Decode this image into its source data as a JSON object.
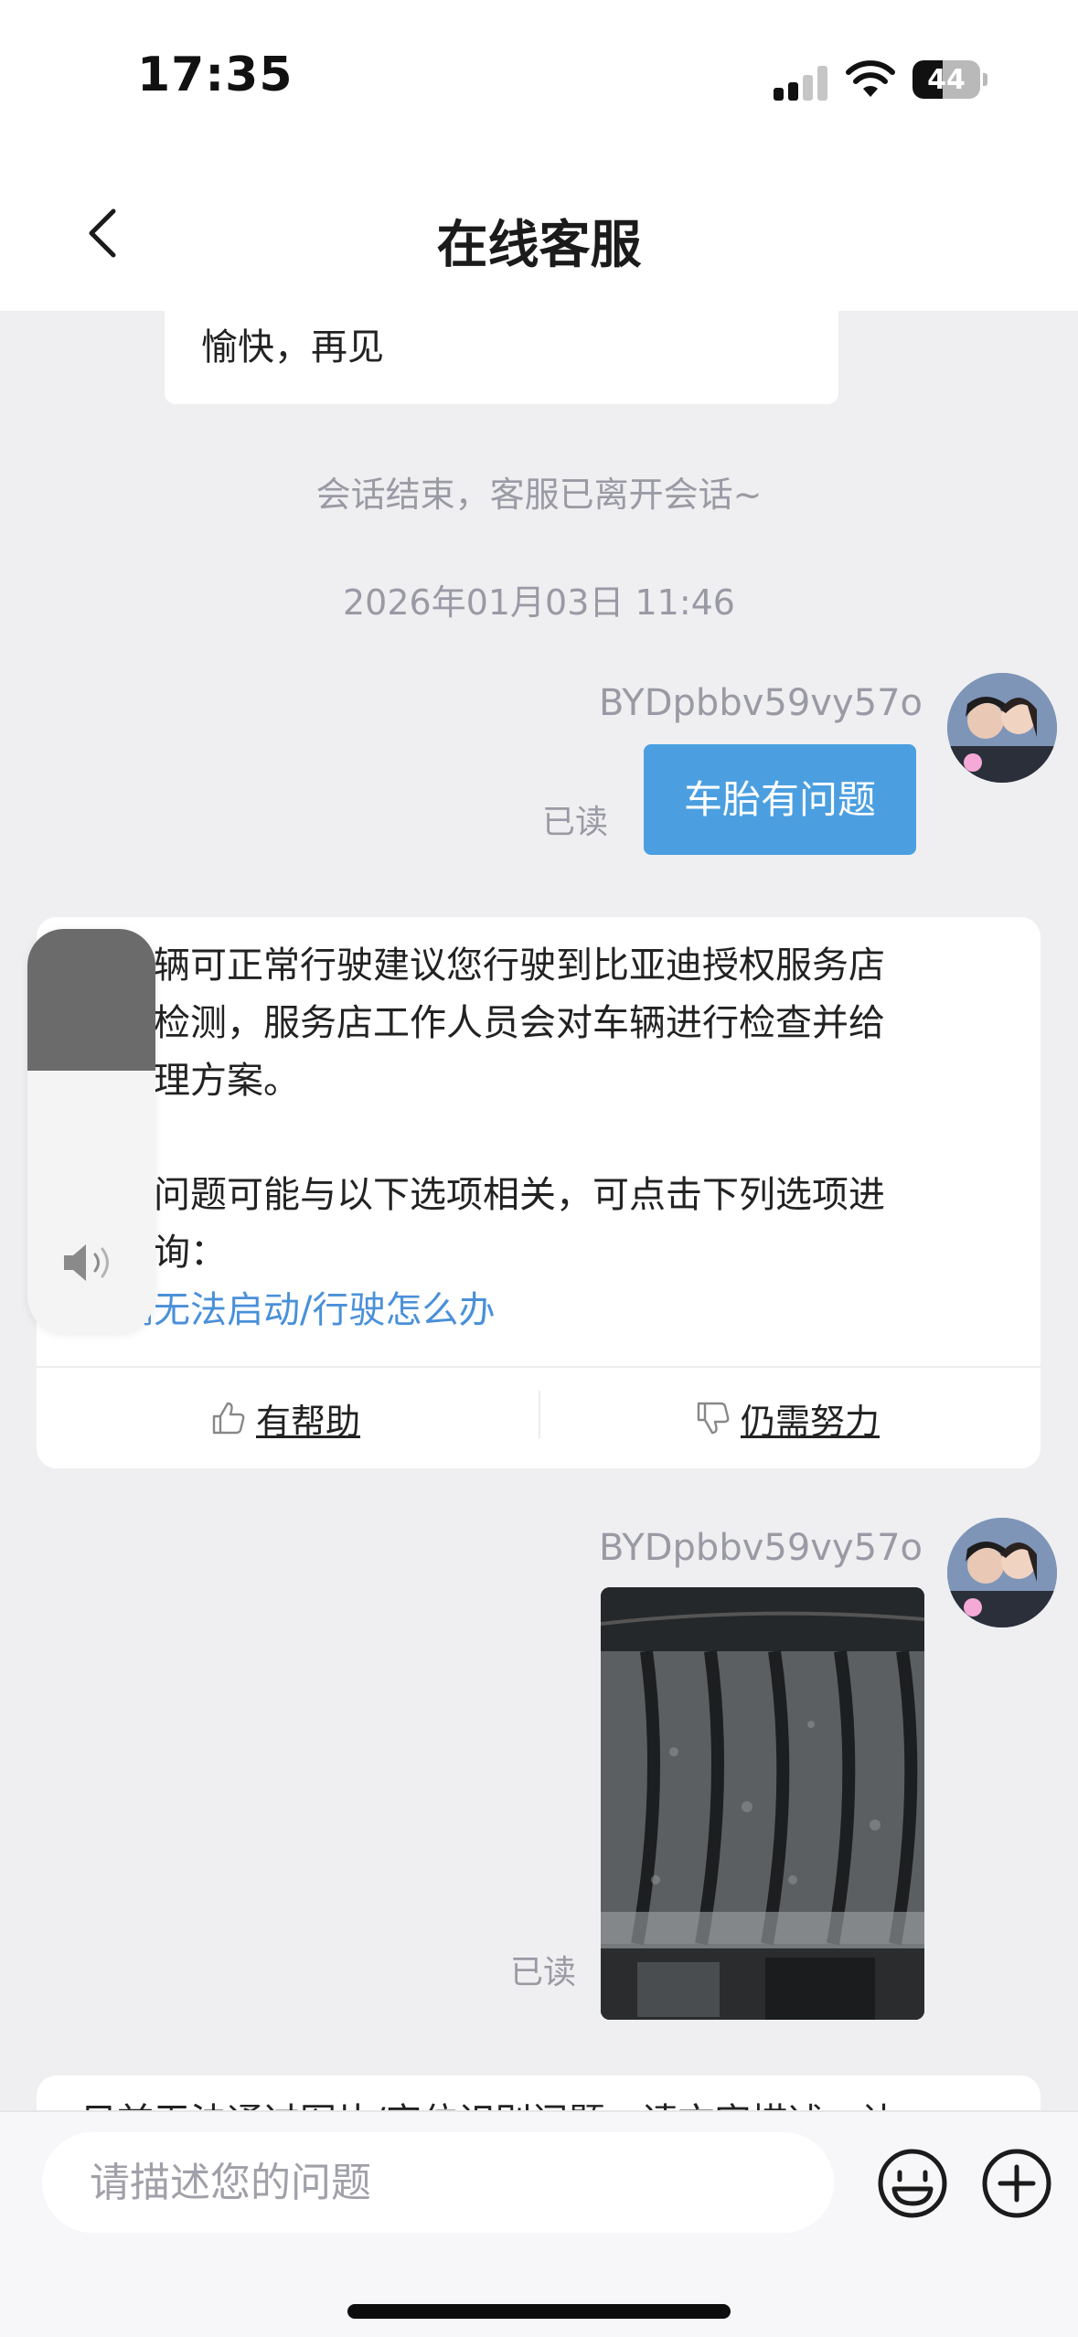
{
  "status_bar": {
    "time": "17:35",
    "battery_level": "44",
    "battery_fraction": 0.44,
    "icons": [
      "signal-icon",
      "wifi-icon",
      "battery-icon"
    ]
  },
  "header": {
    "title": "在线客服",
    "back_icon": "chevron-left-icon"
  },
  "chat": {
    "prev_agent_message": "愉快，再见",
    "system_notice": "会话结束，客服已离开会话~",
    "timestamp": "2026年01月03日 11:46",
    "user_name": "BYDpbbv59vy57o",
    "user_message_1": "车胎有问题",
    "read_label": "已读",
    "agent_reply": {
      "line1": "若车辆可正常行驶建议您行驶到比亚迪授权服务店",
      "line2": "进行检测，服务店工作人员会对车辆进行检查并给",
      "line3": "予处理方案。",
      "line4": "您的问题可能与以下选项相关，可点击下列选项进",
      "line5": "行咨询：",
      "link": "车辆无法启动/行驶怎么办",
      "helpful": "有帮助",
      "not_helpful": "仍需努力"
    },
    "user_message_2_type": "image",
    "agent_reply_2_partial": "目前无法通过图片/定位识别问题，请文字描述，让"
  },
  "volume_overlay": {
    "level": 0.35
  },
  "input": {
    "placeholder": "请描述您的问题",
    "value": ""
  },
  "colors": {
    "accent": "#4b9fe0",
    "link": "#4a90d9",
    "background": "#efeff1",
    "muted_text": "#9a9aa5"
  }
}
